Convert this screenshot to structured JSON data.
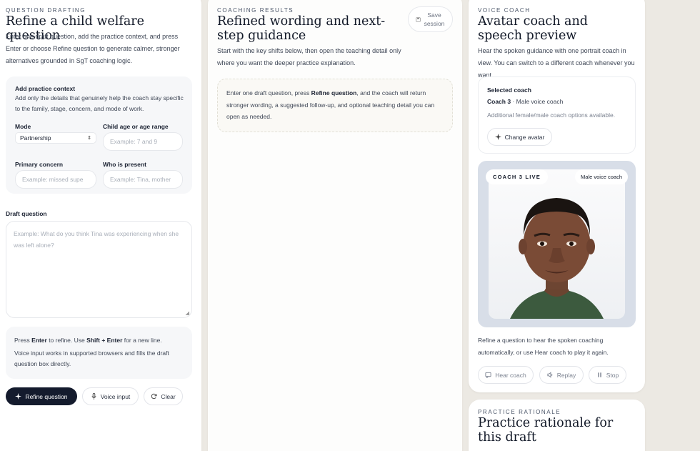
{
  "drafting": {
    "eyebrow": "QUESTION DRAFTING",
    "title": "Refine a child welfare question",
    "description": "Enter one draft question, add the practice context, and press Enter or choose Refine question to generate calmer, stronger alternatives grounded in SgT coaching logic.",
    "context": {
      "heading": "Add practice context",
      "description": "Add only the details that genuinely help the coach stay specific to the family, stage, concern, and mode of work.",
      "mode_label": "Mode",
      "mode_value": "Partnership",
      "age_label": "Child age or age range",
      "age_placeholder": "Example: 7 and 9",
      "concern_label": "Primary concern",
      "concern_placeholder": "Example: missed supe",
      "present_label": "Who is present",
      "present_placeholder": "Example: Tina, mother"
    },
    "draft_label": "Draft question",
    "draft_placeholder": "Example: What do you think Tina was experiencing when she was left alone?",
    "hint": {
      "l1_pre": "Press ",
      "l1_key1": "Enter",
      "l1_mid": " to refine. Use ",
      "l1_key2": "Shift + Enter",
      "l1_post": " for a new line.",
      "l2": "Voice input works in supported browsers and fills the draft question box directly."
    },
    "buttons": {
      "refine": "Refine question",
      "voice": "Voice input",
      "clear": "Clear"
    }
  },
  "results": {
    "eyebrow": "COACHING RESULTS",
    "title": "Refined wording and next-step guidance",
    "description": "Start with the key shifts below, then open the teaching detail only where you want the deeper practice explanation.",
    "save_button": "Save session",
    "empty": {
      "pre": "Enter one draft question, press ",
      "bold": "Refine question",
      "post": ", and the coach will return stronger wording, a suggested follow-up, and optional teaching detail you can open as needed."
    }
  },
  "voice_coach": {
    "eyebrow": "VOICE COACH",
    "title": "Avatar coach and speech preview",
    "description": "Hear the spoken guidance with one portrait coach in view. You can switch to a different coach whenever you want.",
    "selected_label": "Selected coach",
    "coach_name": "Coach 3",
    "coach_voice": "Male voice coach",
    "options_note": "Additional female/male coach options available.",
    "change_avatar": "Change avatar",
    "live_badge": "COACH 3 LIVE",
    "voice_badge": "Male voice coach",
    "footer_text": "Refine a question to hear the spoken coaching automatically, or use Hear coach to play it again.",
    "buttons": {
      "hear": "Hear coach",
      "replay": "Replay",
      "stop": "Stop"
    }
  },
  "rationale": {
    "eyebrow": "PRACTICE RATIONALE",
    "title": "Practice rationale for this draft"
  }
}
